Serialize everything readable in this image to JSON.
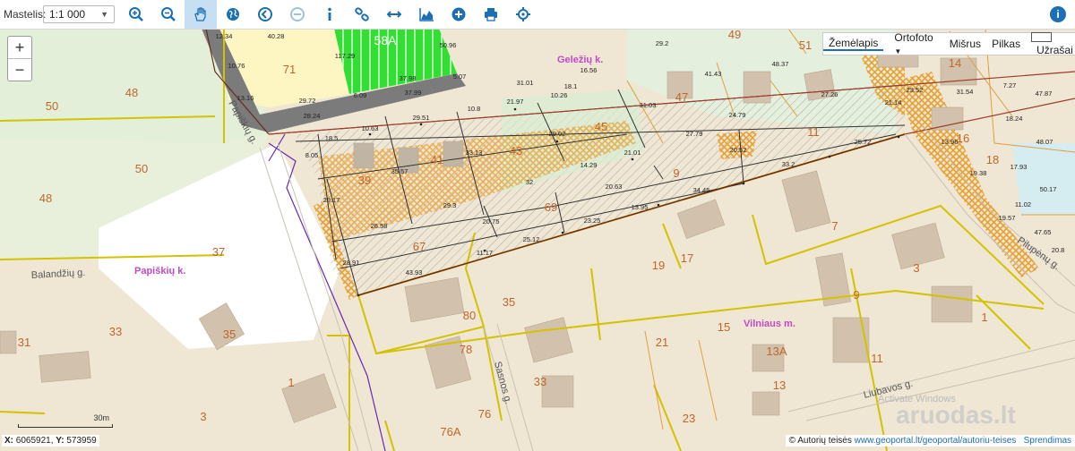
{
  "toolbar": {
    "scale_label": "Mastelis:",
    "scale_value": "1:1 000",
    "tools": [
      {
        "name": "zoom-in-tool-icon",
        "active": false
      },
      {
        "name": "zoom-out-tool-icon",
        "active": false
      },
      {
        "name": "pan-hand-tool-icon",
        "active": true
      },
      {
        "name": "globe-tool-icon",
        "active": false
      },
      {
        "name": "previous-extent-icon",
        "active": false
      },
      {
        "name": "next-extent-icon",
        "active": false
      },
      {
        "name": "identify-info-icon",
        "active": false
      },
      {
        "name": "link-icon",
        "active": false
      },
      {
        "name": "measure-distance-icon",
        "active": false
      },
      {
        "name": "elevation-profile-icon",
        "active": false
      },
      {
        "name": "add-icon",
        "active": false
      },
      {
        "name": "print-icon",
        "active": false
      },
      {
        "name": "locate-crosshair-icon",
        "active": false
      }
    ]
  },
  "layers": {
    "zemelapis": "Žemėlapis",
    "ortofoto": "Ortofoto",
    "misrus": "Mišrus",
    "pilkas": "Pilkas",
    "uzrasai": "Užrašai"
  },
  "scalebar": "30m",
  "coords": {
    "x_label": "X:",
    "x": "6065921",
    "y_label": "Y:",
    "y": "573959"
  },
  "attribution": {
    "prefix": "© Autorių teisės",
    "link": "www.geoportal.lt/geoportal/autoriu-teises",
    "solutions": "Sprendimas"
  },
  "watermark": {
    "activate": "Activate Windows",
    "site": "aruodas.lt"
  },
  "colors": {
    "parcel_line": "#d4c200",
    "parcel_number": "#c0662a",
    "locality": "#c04ac8",
    "hatch_orange": "#e8a030",
    "green_field": "#33dd33"
  },
  "place_labels": [
    "Papiškių k.",
    "Geležių k.",
    "Vilniaus m."
  ],
  "streets": [
    "Papiškių g.",
    "Balandžių g.",
    "Sasnos g.",
    "Liubavos g.",
    "Pilupėnų g."
  ],
  "parcel_numbers": [
    "58A",
    "71",
    "48",
    "50",
    "50",
    "48",
    "49",
    "51",
    "14",
    "47",
    "45",
    "43",
    "41",
    "39",
    "11",
    "9",
    "16",
    "18",
    "69",
    "67",
    "37",
    "7",
    "19",
    "17",
    "3",
    "35",
    "80",
    "9",
    "21",
    "15",
    "13A",
    "11",
    "1",
    "33",
    "35",
    "31",
    "78",
    "1",
    "33",
    "3",
    "76",
    "23",
    "76A",
    "13"
  ],
  "dimensions": [
    "12.34",
    "40.28",
    "117.29",
    "50.96",
    "10.76",
    "37.98",
    "5.07",
    "29.72",
    "6.09",
    "37.99",
    "13.16",
    "28.24",
    "31.01",
    "10.26",
    "16.56",
    "29.2",
    "27.26",
    "10.63",
    "29.51",
    "21.97",
    "31.03",
    "41.43",
    "48.37",
    "31.54",
    "47.87",
    "18.5",
    "8.05",
    "33.13",
    "29.02",
    "27.79",
    "24.79",
    "25.72",
    "18.24",
    "48.07",
    "35.57",
    "14.29",
    "21.01",
    "20.52",
    "33.2",
    "17.93",
    "29.17",
    "32",
    "20.63",
    "34.45",
    "50.17",
    "26.58",
    "29.3",
    "20.75",
    "23.25",
    "13.95",
    "11.02",
    "25.12",
    "11.17",
    "28.91",
    "43.93",
    "47.65",
    "20.8",
    "19.57",
    "13.96",
    "18.1",
    "19.38",
    "23.52",
    "21.14",
    "10.8",
    "7.27"
  ]
}
